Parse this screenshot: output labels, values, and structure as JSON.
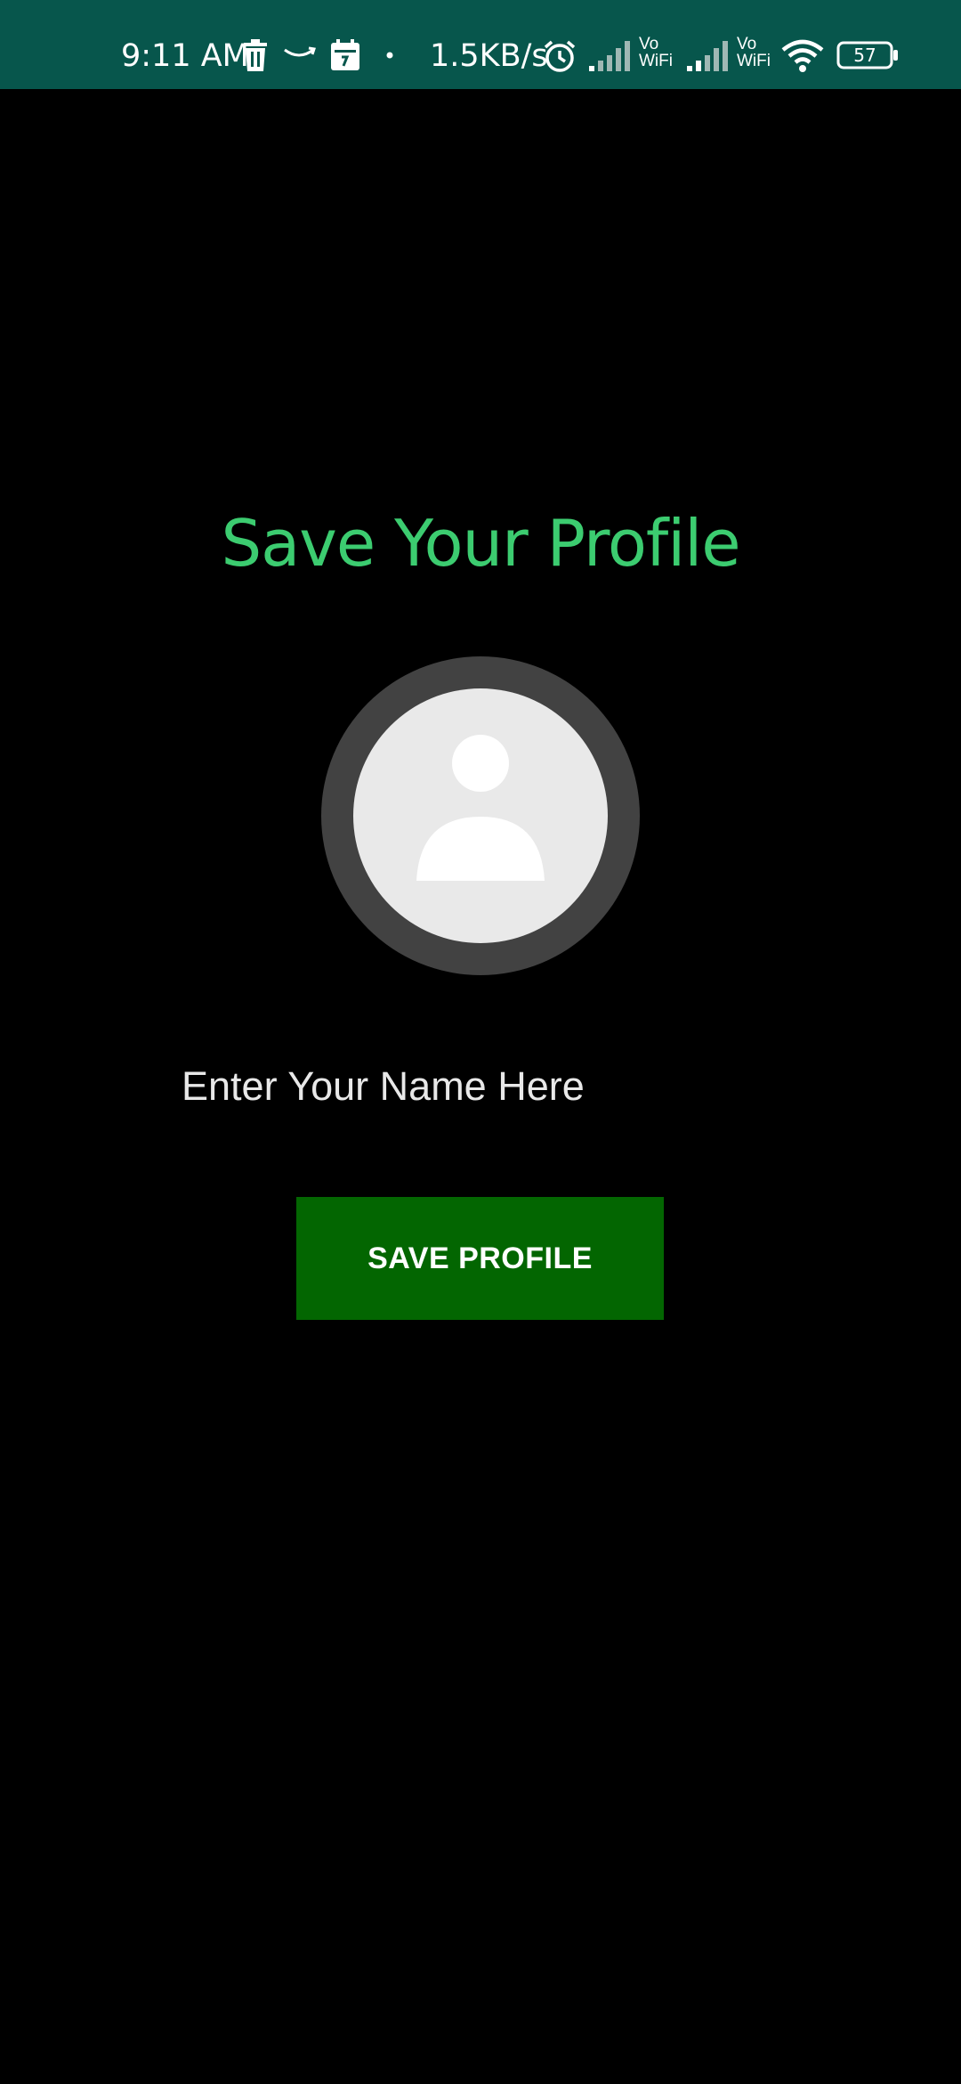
{
  "status_bar": {
    "time": "9:11 AM",
    "network_speed": "1.5KB/s",
    "battery_level": "57",
    "vowifi_1": {
      "line1": "Vo",
      "line2": "WiFi"
    },
    "vowifi_2": {
      "line1": "Vo",
      "line2": "WiFi"
    },
    "icons": [
      "trash-icon",
      "amazon-icon",
      "calendar-icon",
      "dot-icon",
      "alarm-icon",
      "signal-icon",
      "signal-icon",
      "wifi-icon",
      "battery-icon"
    ],
    "background_color": "#07564c"
  },
  "main": {
    "title": "Save Your Profile",
    "title_color": "#3ccc70",
    "avatar_icon": "default-profile-icon",
    "name_input": {
      "value": "",
      "placeholder": "Enter Your Name Here"
    },
    "save_button": {
      "label": "SAVE PROFILE",
      "color": "#036601"
    }
  }
}
